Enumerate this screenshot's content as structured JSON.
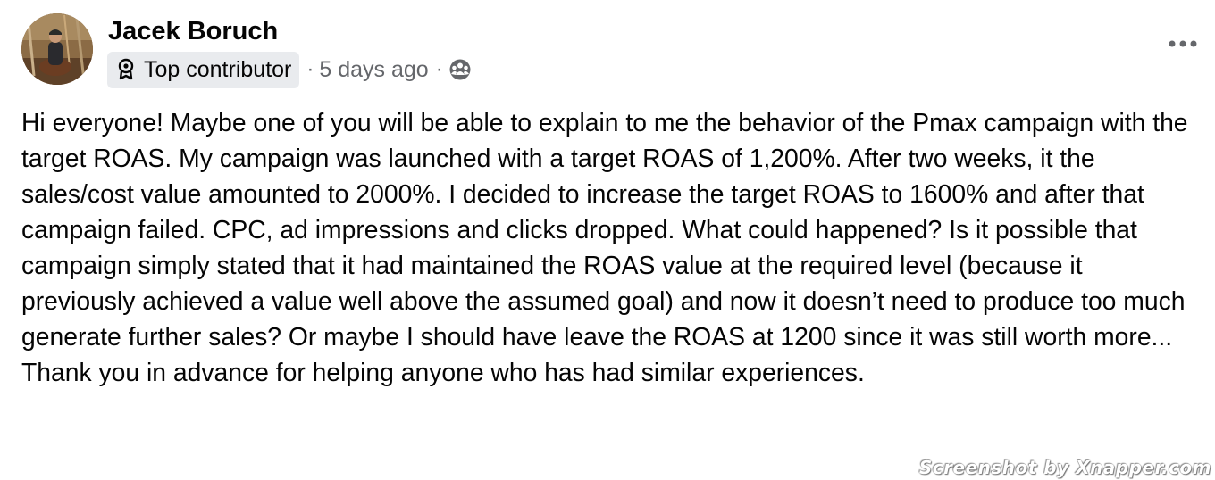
{
  "post": {
    "author": {
      "name": "Jacek Boruch",
      "avatar_icon": "profile-photo"
    },
    "badge": {
      "icon": "contributor-badge-icon",
      "label": "Top contributor"
    },
    "separator": "·",
    "timestamp": "5 days ago",
    "audience_icon": "group-audience-icon",
    "more_icon": "more-options-icon",
    "body": "Hi everyone! Maybe one of you will be able to explain to me the behavior of the Pmax campaign with the target ROAS. My campaign was launched with a target ROAS of 1,200%. After two weeks, it the sales/cost value amounted to 2000%. I decided to increase the target ROAS to 1600% and after that campaign failed. CPC, ad impressions and clicks dropped. What could happened? Is it possible that campaign simply stated that it had maintained the ROAS value at the required level (because it previously achieved a value well above the assumed goal) and now it doesn’t need to produce too much generate further sales? Or maybe I should have leave the ROAS at 1200 since it was still worth more... Thank you in advance for helping anyone who has had similar experiences."
  },
  "watermark": "Screenshot by Xnapper.com",
  "colors": {
    "text_primary": "#050505",
    "text_secondary": "#65676b",
    "badge_bg": "#e9ebee",
    "background": "#ffffff"
  }
}
